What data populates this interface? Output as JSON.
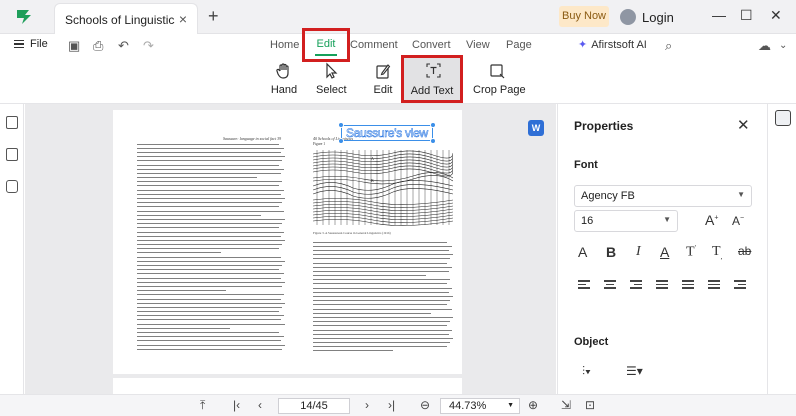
{
  "titlebar": {
    "tab_title": "Schools of Linguistics-S... *",
    "tab_close": "×",
    "new_tab": "+",
    "buy_now": "Buy Now",
    "login": "Login",
    "minimize": "—",
    "maximize": "☐",
    "close": "✕"
  },
  "menubar": {
    "file": "File",
    "tabs": [
      "Home",
      "Edit",
      "Comment",
      "Convert",
      "View",
      "Page"
    ],
    "active_tab": "Edit",
    "ai_label": "Afirstsoft AI"
  },
  "ribbon": {
    "tools": [
      "Hand",
      "Select",
      "Edit",
      "Add Text",
      "Crop Page"
    ],
    "highlighted_tool": "Add Text"
  },
  "document": {
    "left_running_head": "Saussure: language in social fact  39",
    "right_running_head": "40  Schools of Linguistics",
    "figure_label": "Figure 1",
    "caption": "Figure 3. A Saussurean Course in General Linguistics (1916)",
    "added_text": "Saussure's view",
    "figure_letters": [
      "A",
      "B"
    ],
    "translate_badge": "W"
  },
  "properties": {
    "title": "Properties",
    "font_section": "Font",
    "font_family": "Agency FB",
    "font_size": "16",
    "object_section": "Object"
  },
  "statusbar": {
    "page_indicator": "14/45",
    "zoom": "44.73%"
  },
  "colors": {
    "accent_green": "#16a05a",
    "highlight_red": "#d21f1f",
    "selection_blue": "#3b8fe8",
    "buy_now_bg": "#fde8c8"
  }
}
